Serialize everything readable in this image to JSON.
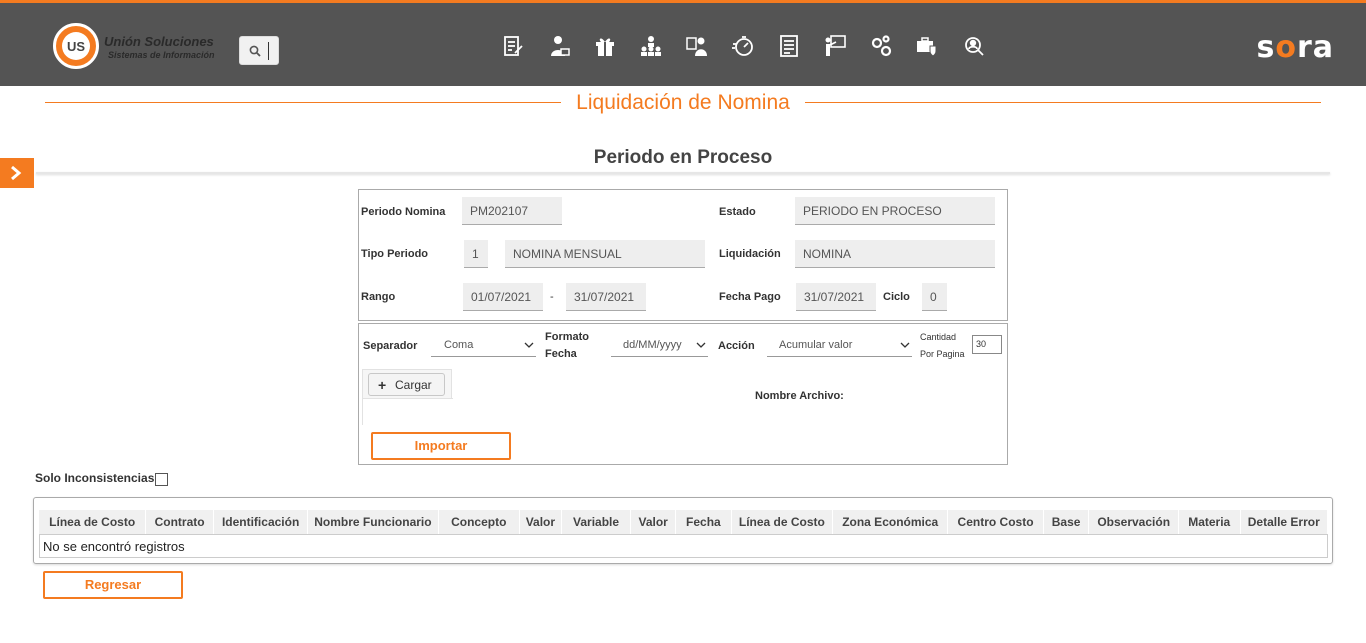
{
  "header": {
    "logo_mark": "US",
    "logo_name": "Unión Soluciones",
    "logo_sub": "Sistemas de Información",
    "brand_left": "s",
    "brand_o": "o",
    "brand_right": "ra",
    "nav_icons": [
      "document-edit-icon",
      "user-card-icon",
      "gift-icon",
      "org-chart-icon",
      "people-badge-icon",
      "timer-icon",
      "list-document-icon",
      "presentation-icon",
      "gears-icon",
      "briefcase-shield-icon",
      "search-people-icon"
    ]
  },
  "page": {
    "title": "Liquidación de Nomina",
    "subtitle": "Periodo en Proceso"
  },
  "period": {
    "periodo_nomina_label": "Periodo Nomina",
    "periodo_nomina_value": "PM202107",
    "estado_label": "Estado",
    "estado_value": "PERIODO EN PROCESO",
    "tipo_periodo_label": "Tipo Periodo",
    "tipo_periodo_code": "1",
    "tipo_periodo_value": "NOMINA MENSUAL",
    "liquidacion_label": "Liquidación",
    "liquidacion_value": "NOMINA",
    "rango_label": "Rango",
    "rango_desde": "01/07/2021",
    "rango_sep": "-",
    "rango_hasta": "31/07/2021",
    "fecha_pago_label": "Fecha Pago",
    "fecha_pago_value": "31/07/2021",
    "ciclo_label": "Ciclo",
    "ciclo_value": "0"
  },
  "import": {
    "separador_label": "Separador",
    "separador_value": "Coma",
    "formato_label_1": "Formato",
    "formato_label_2": "Fecha",
    "formato_value": "dd/MM/yyyy",
    "accion_label": "Acción",
    "accion_value": "Acumular valor",
    "cantidad_label_1": "Cantidad",
    "cantidad_label_2": "Por Pagina",
    "cantidad_value": "30",
    "cargar_label": "Cargar",
    "nombre_archivo_label": "Nombre Archivo:",
    "importar_label": "Importar"
  },
  "filter": {
    "solo_inconsistencias_label": "Solo Inconsistencias"
  },
  "table": {
    "columns": [
      "Línea de Costo",
      "Contrato",
      "Identificación",
      "Nombre Funcionario",
      "Concepto",
      "Valor",
      "Variable",
      "Valor",
      "Fecha",
      "Línea de Costo",
      "Zona Económica",
      "Centro Costo",
      "Base",
      "Observación",
      "Materia",
      "Detalle Error"
    ],
    "empty_message": "No se encontró registros"
  },
  "footer": {
    "regresar_label": "Regresar"
  },
  "colors": {
    "accent": "#f47b20",
    "topbar": "#545454"
  }
}
